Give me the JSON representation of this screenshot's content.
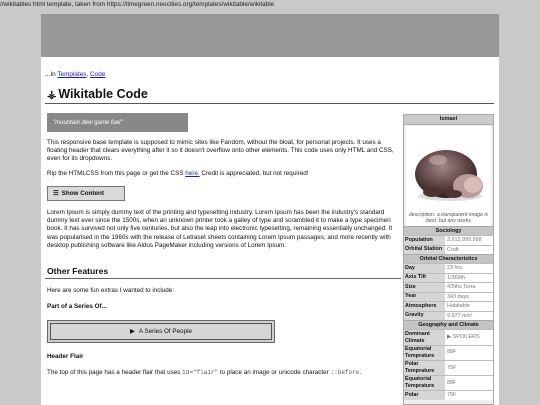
{
  "browser": {
    "path_text": "//wikitables html template, taken from https://limegreen.neocities.org/templates/wikitable/wikitable"
  },
  "breadcrumb": {
    "prefix": "...In",
    "link1": "Templates",
    "sep": ",",
    "link2": "Code"
  },
  "page": {
    "title": "Wikitable Code",
    "flair": "⚶"
  },
  "quote": {
    "text": "\"mountain dew game fuel\""
  },
  "content": {
    "p1": "This responsive base template is supposed to mimic sites like Fandom, without the bloat, for personal projects. It uses a floating header that clears everything after it so it doesn't overflow onto other elements. This code uses only HTML and CSS, even for its dropdowns.",
    "p2_before": "Rip the HTMLCSS from this page or get the CSS",
    "p2_link": "here.",
    "p2_after": "Credit is appreciated, but not required!",
    "show_content": "Show Content",
    "show_icon": "☰",
    "lorem": "Lorem Ipsum is simply dummy text of the printing and typesetting industry. Lorem Ipsum has been the industry's standard dummy text ever since the 1500s, when an unknown printer took a galley of type and scrambled it to make a type specimen book. It has survived not only five centuries, but also the leap into electronic typesetting, remaining essentially unchanged. It was popularised in the 1960s with the release of Letraset sheets containing Lorem Ipsum passages, and more recently with desktop publishing software like Aldus PageMaker including versions of Lorem Ipsum.",
    "other_features": "Other Features",
    "extras": "Here are some fun extras I wanted to include:",
    "series_heading": "Part of a Series Of...",
    "series_button": "A Series Of People",
    "series_icon": "▶",
    "flair_heading": "Header Flair",
    "flair_p_before": "The top of this page has a header flair that uses",
    "flair_code1": "id=\"flair\"",
    "flair_p_mid": "to place an image or unicode character",
    "flair_code2": "::before",
    "flair_p_end": "."
  },
  "infobox": {
    "title": "Ismael",
    "caption": "description. a transparent image is best, but any works",
    "sections": [
      {
        "heading": "Sociology",
        "rows": [
          {
            "k": "Population",
            "v": "3,912,999,998"
          },
          {
            "k": "Orbital Station",
            "v": "Craft"
          }
        ]
      },
      {
        "heading": "Orbital Characteristics",
        "rows": [
          {
            "k": "Day",
            "v": "23 hrs."
          },
          {
            "k": "Axis Tilt",
            "v": "1/369th"
          },
          {
            "k": "Size",
            "v": "4/5ths Terra"
          },
          {
            "k": "Year",
            "v": "343 days"
          },
          {
            "k": "Atmosphere",
            "v": "Habitable"
          },
          {
            "k": "Gravity",
            "v": "9.977 m/s²"
          }
        ]
      },
      {
        "heading": "Geography and Climate",
        "rows": [
          {
            "k": "Dominant Climate",
            "v": "▶ SPOILERS"
          },
          {
            "k": "Equatorial Temprature",
            "v": "88F"
          },
          {
            "k": "Polar Temprature",
            "v": "75F"
          },
          {
            "k": "Equatorial Temprature",
            "v": "88F"
          },
          {
            "k": "Polar",
            "v": "75F"
          }
        ]
      }
    ]
  }
}
